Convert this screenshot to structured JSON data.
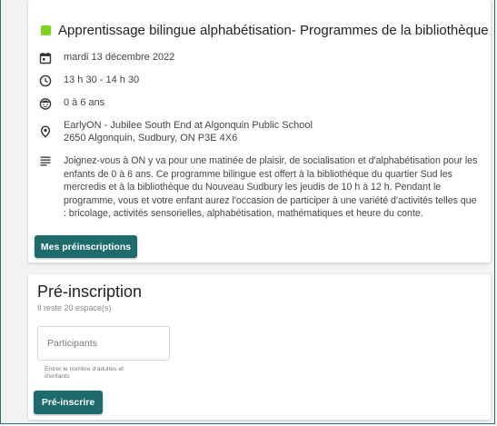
{
  "event": {
    "title": "Apprentissage bilingue alphabétisation- Programmes de la bibliothèque",
    "category_color": "#7ed321",
    "date": "mardi 13 décembre 2022",
    "time": "13 h 30 - 14 h 30",
    "age": "0 à 6 ans",
    "location_name": "EarlyON - Jubilee South End at Algonquin Public School",
    "location_address": "2650 Algonquin, Sudbury, ON P3E 4X6",
    "description": "Joignez-vous à ON y va pour une matinée de plaisir, de socialisation et d'alphabétisation pour les enfants de 0 à 6 ans. Ce programme bilingue est offert à la bibliothèque du quartier Sud les mercredis et à la bibliothèque du Nouveau Sudbury les jeudis de 10 h à 12 h. Pendant le programme, vous et votre enfant aurez l'occasion de participer à une variété d'activités telles que : bricolage, activités sensorielles, alphabétisation, mathématiques et heure du conte.",
    "icons": [
      "calendar-icon",
      "clock-icon",
      "child-face-icon",
      "location-pin-icon",
      "description-lines-icon"
    ],
    "my_registrations_label": "Mes préinscriptions"
  },
  "registration": {
    "title": "Pré-inscription",
    "remaining": "Il reste 20 espace(s)",
    "participants_placeholder": "Participants",
    "participants_value": "",
    "helper": "Entrer le nombre d'adultes et d'enfants",
    "register_label": "Pré-inscrire"
  },
  "colors": {
    "accent": "#1e6b6e",
    "frame_border": "#2a6f73",
    "category": "#7ed321",
    "background": "#f2f2f2"
  }
}
